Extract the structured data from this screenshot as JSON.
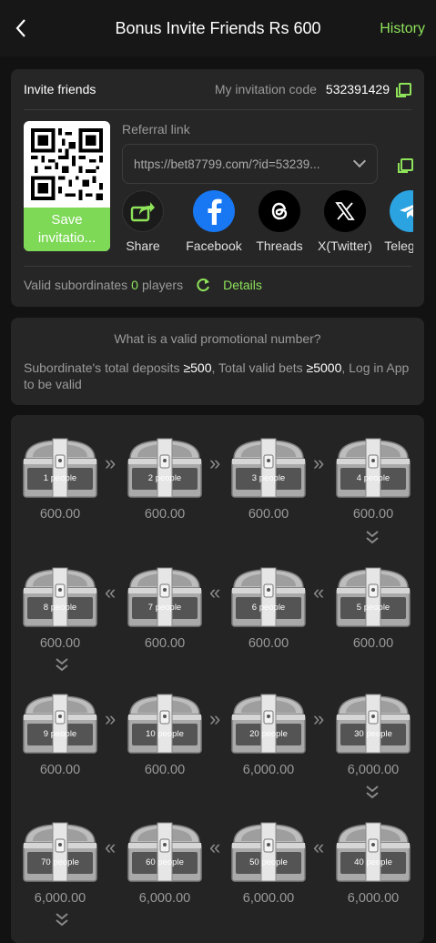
{
  "header": {
    "title": "Bonus Invite Friends Rs 600",
    "history": "History"
  },
  "invite": {
    "label": "Invite friends",
    "code_label": "My invitation code",
    "code": "532391429",
    "save_label_1": "Save",
    "save_label_2": "invitatio...",
    "referral_label": "Referral link",
    "referral_value": "https://bet87799.com/?id=53239..."
  },
  "socials": [
    {
      "name": "Share",
      "icon": "share-icon"
    },
    {
      "name": "Facebook",
      "icon": "facebook-icon"
    },
    {
      "name": "Threads",
      "icon": "threads-icon"
    },
    {
      "name": "X(Twitter)",
      "icon": "x-icon"
    },
    {
      "name": "Telegram",
      "icon": "telegram-icon"
    }
  ],
  "valid": {
    "prefix": "Valid subordinates",
    "count": "0",
    "suffix": "players",
    "details": "Details"
  },
  "info": {
    "question": "What is a valid promotional number?",
    "a1": "Subordinate's total deposits ",
    "a2": "≥500",
    "a3": ", Total valid bets ",
    "a4": "≥5000",
    "a5": ", Log in App to be valid"
  },
  "rewards": [
    {
      "people": "1 people",
      "amount": "600.00"
    },
    {
      "people": "2 people",
      "amount": "600.00"
    },
    {
      "people": "3 people",
      "amount": "600.00"
    },
    {
      "people": "4 people",
      "amount": "600.00"
    },
    {
      "people": "8 people",
      "amount": "600.00"
    },
    {
      "people": "7 people",
      "amount": "600.00"
    },
    {
      "people": "6 people",
      "amount": "600.00"
    },
    {
      "people": "5 people",
      "amount": "600.00"
    },
    {
      "people": "9 people",
      "amount": "600.00"
    },
    {
      "people": "10 people",
      "amount": "600.00"
    },
    {
      "people": "20 people",
      "amount": "6,000.00"
    },
    {
      "people": "30 people",
      "amount": "6,000.00"
    },
    {
      "people": "70 people",
      "amount": "6,000.00"
    },
    {
      "people": "60 people",
      "amount": "6,000.00"
    },
    {
      "people": "50 people",
      "amount": "6,000.00"
    },
    {
      "people": "40 people",
      "amount": "6,000.00"
    }
  ],
  "colors": {
    "accent": "#8ee35a",
    "background": "#121212",
    "card": "#262626"
  }
}
